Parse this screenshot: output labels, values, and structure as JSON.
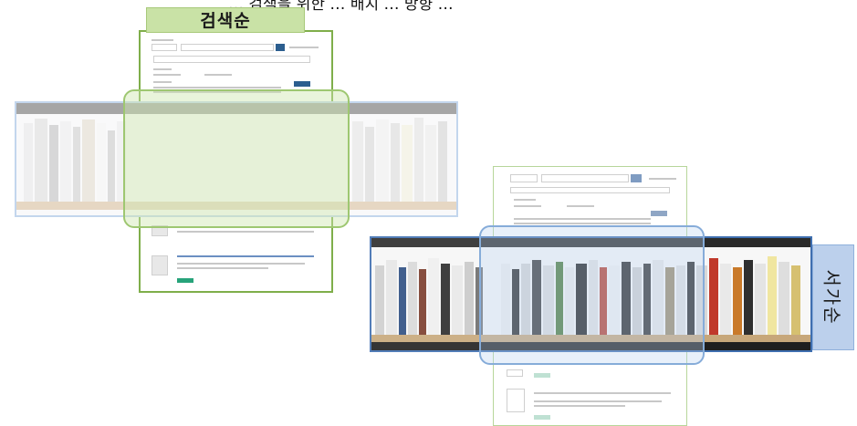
{
  "header": {
    "cut_text": "… 검색을 위한 … 배치 … 방향 …"
  },
  "labels": {
    "search_order": "검색순",
    "shelf_order": "서가순"
  },
  "colors": {
    "green": "#7fae4a",
    "green_fill": "#c9e2a6",
    "blue": "#3f6fb0",
    "blue_fill": "#bcd0ec",
    "button_green": "#27a37a"
  },
  "icons": {
    "search": "search-icon"
  }
}
